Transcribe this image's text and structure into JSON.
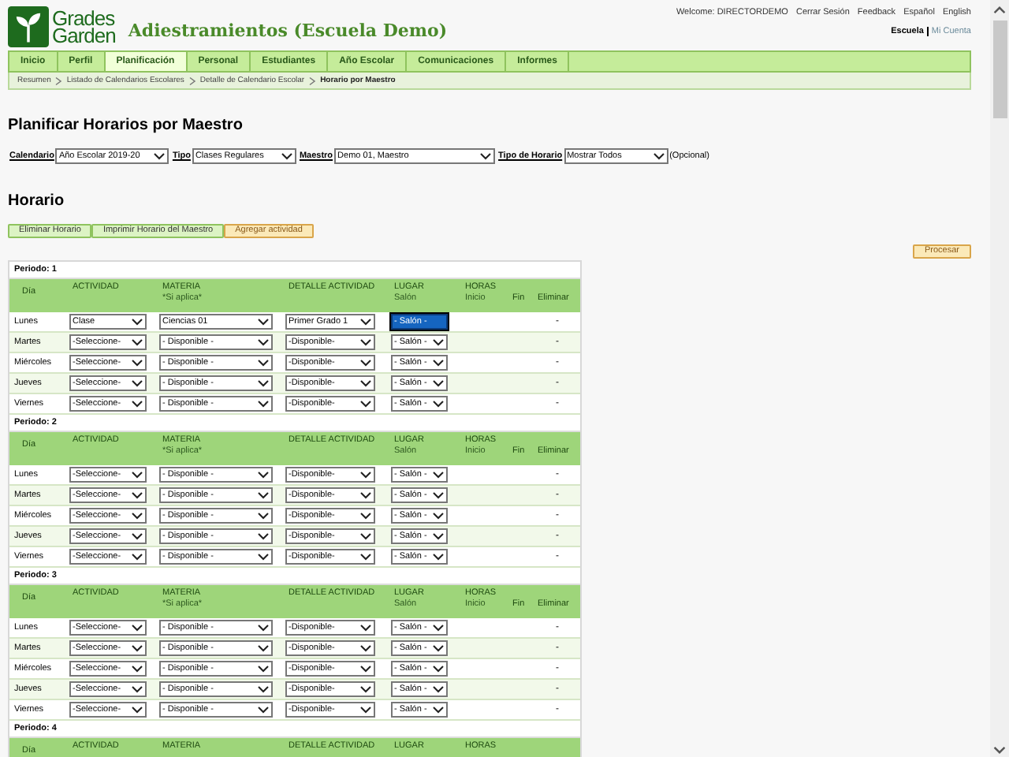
{
  "header": {
    "logo_line_1": "Grades",
    "logo_line_2": "Garden",
    "title": "Adiestramientos (Escuela Demo)",
    "top_links": [
      "Welcome: DIRECTORDEMO",
      "Cerrar Sesión",
      "Feedback",
      "Español",
      "English"
    ],
    "account_links": [
      {
        "label": "Escuela",
        "selected": true
      },
      {
        "label": "Mi Cuenta",
        "selected": false
      }
    ]
  },
  "tabs": [
    {
      "label": "Inicio",
      "selected": false
    },
    {
      "label": "Perfil",
      "selected": false
    },
    {
      "label": "Planificación",
      "selected": true
    },
    {
      "label": "Personal",
      "selected": false
    },
    {
      "label": "Estudiantes",
      "selected": false
    },
    {
      "label": "Año Escolar",
      "selected": false
    },
    {
      "label": "Comunicaciones",
      "selected": false
    },
    {
      "label": "Informes",
      "selected": false
    }
  ],
  "breadcrumbs": [
    "Resumen",
    "Listado de Calendarios Escolares",
    "Detalle de Calendario Escolar",
    "Horario por Maestro"
  ],
  "page_title": "Planificar Horarios por Maestro",
  "filters": [
    {
      "label": "Calendario",
      "value": "Año Escolar 2019-20"
    },
    {
      "label": "Tipo",
      "value": "Clases Regulares"
    },
    {
      "label": "Maestro",
      "value": "Demo 01, Maestro"
    },
    {
      "label": "Tipo de Horario",
      "value": "Mostrar Todos"
    }
  ],
  "filters_note": "(Opcional)",
  "section_title": "Horario",
  "actions": [
    {
      "label": "Eliminar Horario",
      "kind": "green"
    },
    {
      "label": "Imprimir Horario del Maestro",
      "kind": "green"
    },
    {
      "label": "Agregar actividad",
      "kind": "orange"
    }
  ],
  "process_button": "Procesar",
  "periods": [
    {
      "label": "Periodo: 1",
      "columns": [
        {
          "label": "Día"
        },
        {
          "label": "ACTIVIDAD"
        },
        {
          "label": "MATERIA",
          "sub": "*Si aplica*"
        },
        {
          "label": "DETALLE ACTIVIDAD"
        },
        {
          "label": "LUGAR",
          "sub": "Salón"
        },
        {
          "label": "HORAS",
          "sub": "Inicio"
        },
        {
          "label": "Fin"
        },
        {
          "label": "Eliminar"
        }
      ],
      "rows": [
        {
          "day": "Lunes",
          "actividad": "Clase",
          "materia": "Ciencias 01",
          "detalle": "Primer Grado 1",
          "lugar": "- Salón -",
          "lugar_focused": true,
          "eliminar": "-"
        },
        {
          "day": "Martes",
          "actividad": "-Seleccione-",
          "materia": "- Disponible -",
          "detalle": "-Disponible-",
          "lugar": "- Salón -",
          "lugar_focused": false,
          "eliminar": "-"
        },
        {
          "day": "Miércoles",
          "actividad": "-Seleccione-",
          "materia": "- Disponible -",
          "detalle": "-Disponible-",
          "lugar": "- Salón -",
          "lugar_focused": false,
          "eliminar": "-"
        },
        {
          "day": "Jueves",
          "actividad": "-Seleccione-",
          "materia": "- Disponible -",
          "detalle": "-Disponible-",
          "lugar": "- Salón -",
          "lugar_focused": false,
          "eliminar": "-"
        },
        {
          "day": "Viernes",
          "actividad": "-Seleccione-",
          "materia": "- Disponible -",
          "detalle": "-Disponible-",
          "lugar": "- Salón -",
          "lugar_focused": false,
          "eliminar": "-"
        }
      ]
    },
    {
      "label": "Periodo: 2",
      "columns": [
        {
          "label": "Día"
        },
        {
          "label": "ACTIVIDAD"
        },
        {
          "label": "MATERIA",
          "sub": "*Si aplica*"
        },
        {
          "label": "DETALLE ACTIVIDAD"
        },
        {
          "label": "LUGAR",
          "sub": "Salón"
        },
        {
          "label": "HORAS",
          "sub": "Inicio"
        },
        {
          "label": "Fin"
        },
        {
          "label": "Eliminar"
        }
      ],
      "rows": [
        {
          "day": "Lunes",
          "actividad": "-Seleccione-",
          "materia": "- Disponible -",
          "detalle": "-Disponible-",
          "lugar": "- Salón -",
          "lugar_focused": false,
          "eliminar": "-"
        },
        {
          "day": "Martes",
          "actividad": "-Seleccione-",
          "materia": "- Disponible -",
          "detalle": "-Disponible-",
          "lugar": "- Salón -",
          "lugar_focused": false,
          "eliminar": "-"
        },
        {
          "day": "Miércoles",
          "actividad": "-Seleccione-",
          "materia": "- Disponible -",
          "detalle": "-Disponible-",
          "lugar": "- Salón -",
          "lugar_focused": false,
          "eliminar": "-"
        },
        {
          "day": "Jueves",
          "actividad": "-Seleccione-",
          "materia": "- Disponible -",
          "detalle": "-Disponible-",
          "lugar": "- Salón -",
          "lugar_focused": false,
          "eliminar": "-"
        },
        {
          "day": "Viernes",
          "actividad": "-Seleccione-",
          "materia": "- Disponible -",
          "detalle": "-Disponible-",
          "lugar": "- Salón -",
          "lugar_focused": false,
          "eliminar": "-"
        }
      ]
    },
    {
      "label": "Periodo: 3",
      "columns": [
        {
          "label": "Día"
        },
        {
          "label": "ACTIVIDAD"
        },
        {
          "label": "MATERIA",
          "sub": "*Si aplica*"
        },
        {
          "label": "DETALLE ACTIVIDAD"
        },
        {
          "label": "LUGAR",
          "sub": "Salón"
        },
        {
          "label": "HORAS",
          "sub": "Inicio"
        },
        {
          "label": "Fin"
        },
        {
          "label": "Eliminar"
        }
      ],
      "rows": [
        {
          "day": "Lunes",
          "actividad": "-Seleccione-",
          "materia": "- Disponible -",
          "detalle": "-Disponible-",
          "lugar": "- Salón -",
          "lugar_focused": false,
          "eliminar": "-"
        },
        {
          "day": "Martes",
          "actividad": "-Seleccione-",
          "materia": "- Disponible -",
          "detalle": "-Disponible-",
          "lugar": "- Salón -",
          "lugar_focused": false,
          "eliminar": "-"
        },
        {
          "day": "Miércoles",
          "actividad": "-Seleccione-",
          "materia": "- Disponible -",
          "detalle": "-Disponible-",
          "lugar": "- Salón -",
          "lugar_focused": false,
          "eliminar": "-"
        },
        {
          "day": "Jueves",
          "actividad": "-Seleccione-",
          "materia": "- Disponible -",
          "detalle": "-Disponible-",
          "lugar": "- Salón -",
          "lugar_focused": false,
          "eliminar": "-"
        },
        {
          "day": "Viernes",
          "actividad": "-Seleccione-",
          "materia": "- Disponible -",
          "detalle": "-Disponible-",
          "lugar": "- Salón -",
          "lugar_focused": false,
          "eliminar": "-"
        }
      ]
    },
    {
      "label": "Periodo: 4",
      "columns": [
        {
          "label": "Día"
        },
        {
          "label": "ACTIVIDAD"
        },
        {
          "label": "MATERIA"
        },
        {
          "label": "DETALLE ACTIVIDAD"
        },
        {
          "label": "LUGAR"
        },
        {
          "label": "HORAS"
        }
      ]
    }
  ]
}
